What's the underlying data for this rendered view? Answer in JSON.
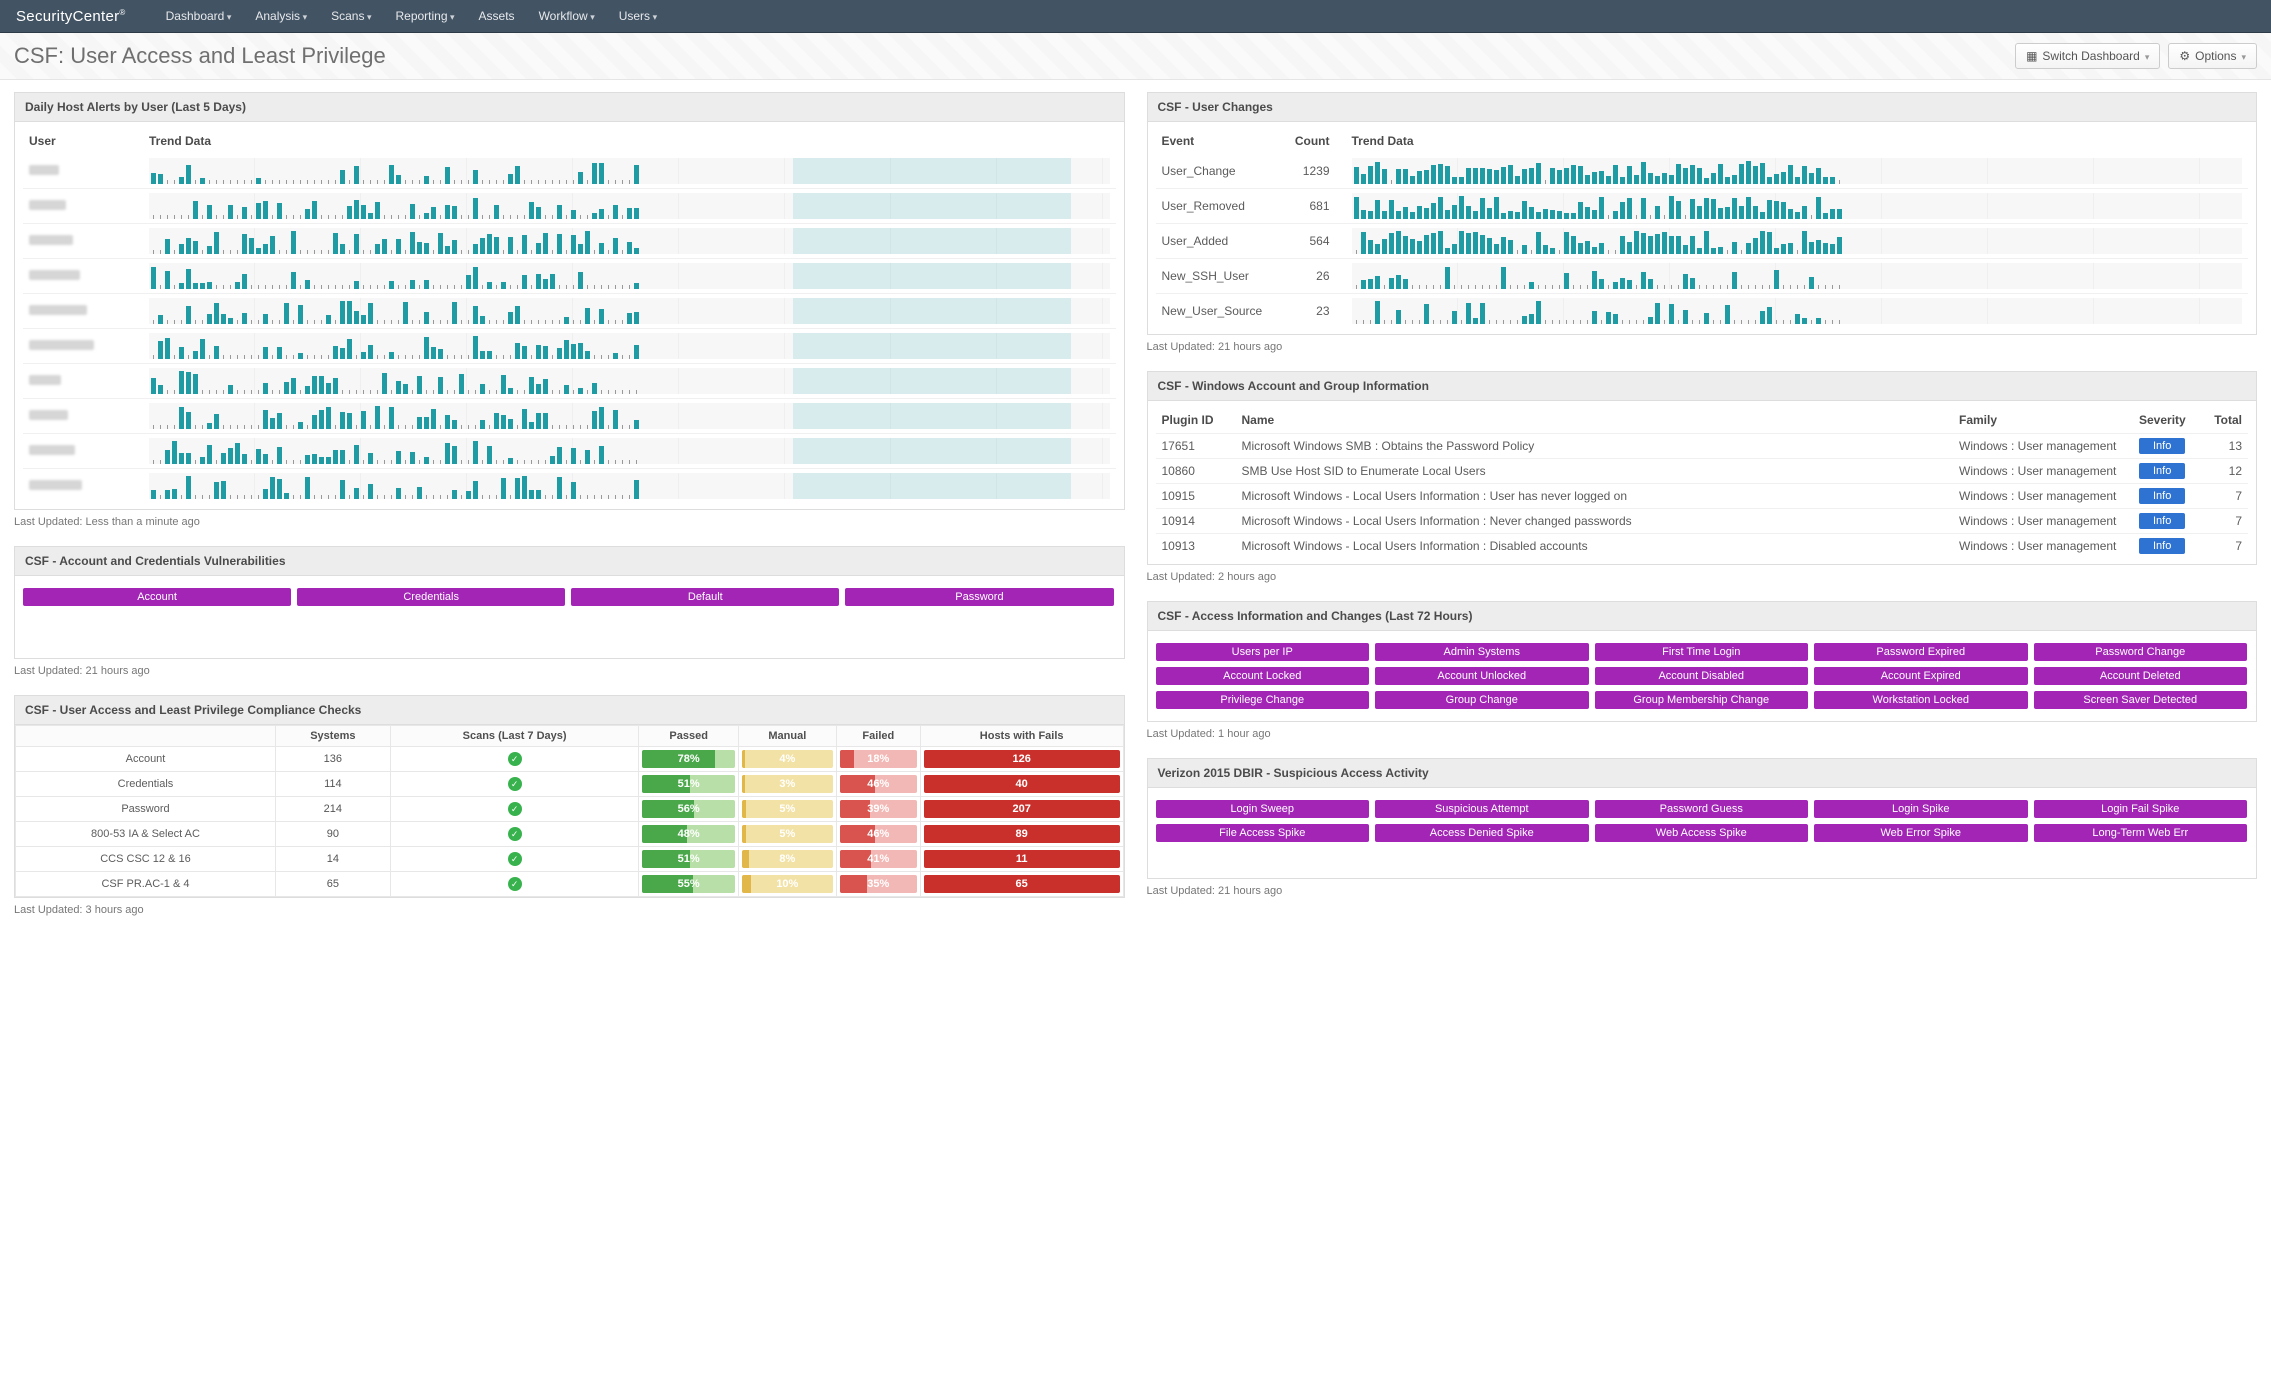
{
  "brand": "SecurityCenter",
  "nav": [
    "Dashboard",
    "Analysis",
    "Scans",
    "Reporting",
    "Assets",
    "Workflow",
    "Users"
  ],
  "page_title": "CSF: User Access and Least Privilege",
  "btn_switch": "Switch Dashboard",
  "btn_options": "Options",
  "p_hostalerts": {
    "title": "Daily Host Alerts by User (Last 5 Days)",
    "headers": {
      "user": "User",
      "trend": "Trend Data"
    },
    "rows": 10,
    "highlight": {
      "start_pct": 67,
      "end_pct": 96
    },
    "footer": "Last Updated: Less than a minute ago"
  },
  "p_acctvuln": {
    "title": "CSF - Account and Credentials Vulnerabilities",
    "pills": [
      "Account",
      "Credentials",
      "Default",
      "Password"
    ],
    "footer": "Last Updated: 21 hours ago"
  },
  "p_compliance": {
    "title": "CSF - User Access and Least Privilege Compliance Checks",
    "headers": [
      "",
      "Systems",
      "Scans (Last 7 Days)",
      "Passed",
      "Manual",
      "Failed",
      "Hosts with Fails"
    ],
    "rows": [
      {
        "label": "Account",
        "systems": 136,
        "passed": 78,
        "manual": 4,
        "failed": 18,
        "hosts": 126
      },
      {
        "label": "Credentials",
        "systems": 114,
        "passed": 51,
        "manual": 3,
        "failed": 46,
        "hosts": 40
      },
      {
        "label": "Password",
        "systems": 214,
        "passed": 56,
        "manual": 5,
        "failed": 39,
        "hosts": 207
      },
      {
        "label": "800-53 IA & Select AC",
        "systems": 90,
        "passed": 48,
        "manual": 5,
        "failed": 46,
        "hosts": 89
      },
      {
        "label": "CCS CSC 12 & 16",
        "systems": 14,
        "passed": 51,
        "manual": 8,
        "failed": 41,
        "hosts": 11
      },
      {
        "label": "CSF PR.AC-1 & 4",
        "systems": 65,
        "passed": 55,
        "manual": 10,
        "failed": 35,
        "hosts": 65
      }
    ],
    "footer": "Last Updated: 3 hours ago"
  },
  "p_userchanges": {
    "title": "CSF - User Changes",
    "headers": {
      "event": "Event",
      "count": "Count",
      "trend": "Trend Data"
    },
    "rows": [
      {
        "event": "User_Change",
        "count": 1239,
        "density": 0.95
      },
      {
        "event": "User_Removed",
        "count": 681,
        "density": 0.9
      },
      {
        "event": "User_Added",
        "count": 564,
        "density": 0.9
      },
      {
        "event": "New_SSH_User",
        "count": 26,
        "density": 0.35
      },
      {
        "event": "New_User_Source",
        "count": 23,
        "density": 0.35
      }
    ],
    "footer": "Last Updated: 21 hours ago"
  },
  "p_wingroup": {
    "title": "CSF - Windows Account and Group Information",
    "headers": {
      "plugin": "Plugin ID",
      "name": "Name",
      "family": "Family",
      "severity": "Severity",
      "total": "Total"
    },
    "rows": [
      {
        "plugin": "17651",
        "name": "Microsoft Windows SMB : Obtains the Password Policy",
        "family": "Windows : User management",
        "severity": "Info",
        "total": 13
      },
      {
        "plugin": "10860",
        "name": "SMB Use Host SID to Enumerate Local Users",
        "family": "Windows : User management",
        "severity": "Info",
        "total": 12
      },
      {
        "plugin": "10915",
        "name": "Microsoft Windows - Local Users Information : User has never logged on",
        "family": "Windows : User management",
        "severity": "Info",
        "total": 7
      },
      {
        "plugin": "10914",
        "name": "Microsoft Windows - Local Users Information : Never changed passwords",
        "family": "Windows : User management",
        "severity": "Info",
        "total": 7
      },
      {
        "plugin": "10913",
        "name": "Microsoft Windows - Local Users Information : Disabled accounts",
        "family": "Windows : User management",
        "severity": "Info",
        "total": 7
      }
    ],
    "footer": "Last Updated: 2 hours ago"
  },
  "p_access72": {
    "title": "CSF - Access Information and Changes (Last 72 Hours)",
    "pills": [
      "Users per IP",
      "Admin Systems",
      "First Time Login",
      "Password Expired",
      "Password Change",
      "Account Locked",
      "Account Unlocked",
      "Account Disabled",
      "Account Expired",
      "Account Deleted",
      "Privilege Change",
      "Group Change",
      "Group Membership Change",
      "Workstation Locked",
      "Screen Saver Detected"
    ],
    "footer": "Last Updated: 1 hour ago"
  },
  "p_dbir": {
    "title": "Verizon 2015 DBIR - Suspicious Access Activity",
    "pills": [
      "Login Sweep",
      "Suspicious Attempt",
      "Password Guess",
      "Login Spike",
      "Login Fail Spike",
      "File Access Spike",
      "Access Denied Spike",
      "Web Access Spike",
      "Web Error Spike",
      "Long-Term Web Err"
    ],
    "footer": "Last Updated: 21 hours ago"
  },
  "colors": {
    "teal": "#1f9ba3",
    "purple": "#a225b6",
    "green_fill": "#4aa84a",
    "green_bg": "#b7dfa7",
    "yellow_fill": "#e1b74a",
    "yellow_bg": "#f3e2a6",
    "red_fill": "#d9534f",
    "red_bg": "#f1b8b5",
    "red_solid": "#c9302c",
    "info_blue": "#2e72d2"
  },
  "chart_data": {
    "host_alerts": {
      "type": "bar",
      "title": "Daily Host Alerts by User (Last 5 Days)",
      "note": "User labels redacted in source image; 10 rows of sparkline bars; highlighted window spans approximately the last third of the timeline.",
      "rows": 10
    },
    "user_changes": {
      "type": "bar",
      "title": "CSF - User Changes",
      "series": [
        {
          "name": "User_Change",
          "total": 1239
        },
        {
          "name": "User_Removed",
          "total": 681
        },
        {
          "name": "User_Added",
          "total": 564
        },
        {
          "name": "New_SSH_User",
          "total": 26
        },
        {
          "name": "New_User_Source",
          "total": 23
        }
      ]
    },
    "compliance_pct": {
      "type": "table",
      "columns": [
        "row",
        "Systems",
        "Passed%",
        "Manual%",
        "Failed%",
        "HostsWithFails"
      ],
      "rows": [
        [
          "Account",
          136,
          78,
          4,
          18,
          126
        ],
        [
          "Credentials",
          114,
          51,
          3,
          46,
          40
        ],
        [
          "Password",
          214,
          56,
          5,
          39,
          207
        ],
        [
          "800-53 IA & Select AC",
          90,
          48,
          5,
          46,
          89
        ],
        [
          "CCS CSC 12 & 16",
          14,
          51,
          8,
          41,
          11
        ],
        [
          "CSF PR.AC-1 & 4",
          65,
          55,
          10,
          35,
          65
        ]
      ]
    }
  }
}
